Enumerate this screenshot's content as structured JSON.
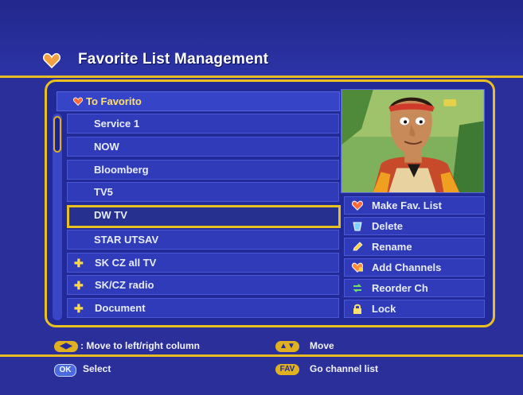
{
  "header": {
    "title": "Favorite List Management"
  },
  "list": {
    "header_label": "To Favorito",
    "rows": [
      {
        "label": "Service 1",
        "type": "channel"
      },
      {
        "label": "NOW",
        "type": "channel"
      },
      {
        "label": "Bloomberg",
        "type": "channel"
      },
      {
        "label": "TV5",
        "type": "channel"
      },
      {
        "label": "DW TV",
        "type": "channel",
        "selected": true
      },
      {
        "label": "STAR UTSAV",
        "type": "channel"
      },
      {
        "label": "SK CZ all TV",
        "type": "folder"
      },
      {
        "label": "SK/CZ radio",
        "type": "folder"
      },
      {
        "label": "Document",
        "type": "folder"
      }
    ]
  },
  "menu": {
    "items": [
      {
        "label": "Make Fav. List",
        "icon": "heart-icon"
      },
      {
        "label": "Delete",
        "icon": "delete-icon"
      },
      {
        "label": "Rename",
        "icon": "pencil-icon"
      },
      {
        "label": "Add Channels",
        "icon": "add-heart-icon"
      },
      {
        "label": "Reorder Ch",
        "icon": "reorder-icon"
      },
      {
        "label": "Lock",
        "icon": "lock-icon"
      }
    ]
  },
  "help": {
    "left_right_key": "◀▶",
    "left_right_text": ": Move to left/right column",
    "updown_key": "▲▼",
    "updown_text": "Move",
    "ok_key": "OK",
    "ok_text": "Select",
    "fav_key": "FAV",
    "fav_text": "Go channel list"
  },
  "colors": {
    "background": "#2a2f9a",
    "accent_gold": "#e8c020",
    "row_fill": "#2f3bb8",
    "header_text": "#ffe070"
  }
}
